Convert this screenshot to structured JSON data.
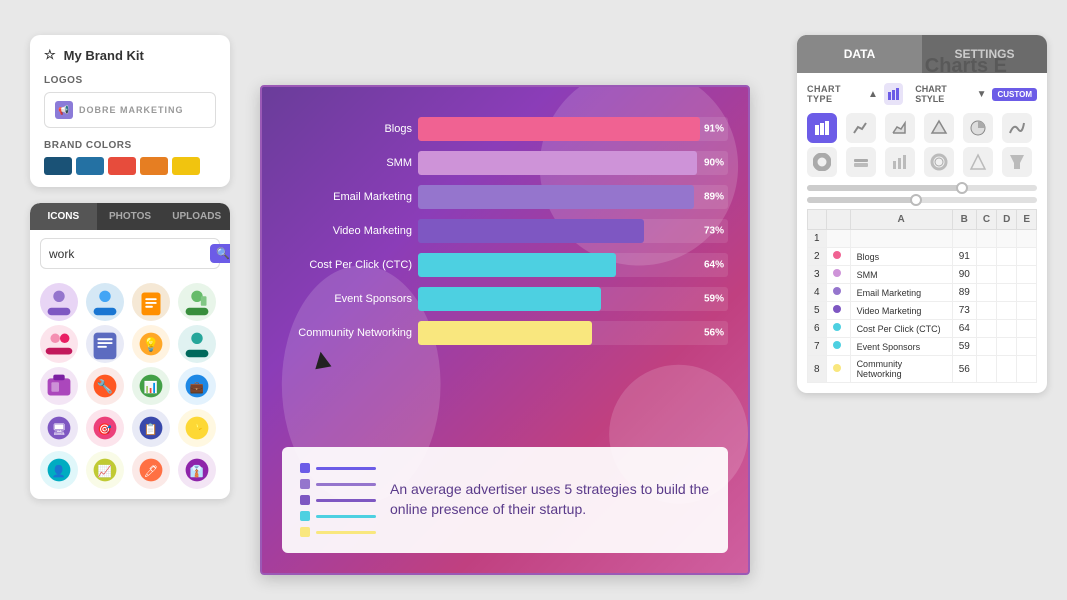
{
  "brandKit": {
    "title": "My Brand Kit",
    "logosLabel": "LOGOS",
    "logoText": "DOBRE MARKETING",
    "brandColorsLabel": "BRAND COLORS",
    "colors": [
      "#1a5276",
      "#2471a3",
      "#e74c3c",
      "#e67e22",
      "#f1c40f"
    ]
  },
  "iconsPanel": {
    "tabs": [
      "ICONS",
      "PHOTOS",
      "UPLOADS"
    ],
    "activeTab": 0,
    "searchPlaceholder": "work",
    "searchLabel": "search"
  },
  "chart": {
    "title": "Charts E",
    "bars": [
      {
        "label": "Blogs",
        "pct": 91,
        "color": "#f06292"
      },
      {
        "label": "SMM",
        "pct": 90,
        "color": "#ce93d8"
      },
      {
        "label": "Email Marketing",
        "pct": 89,
        "color": "#9575cd"
      },
      {
        "label": "Video Marketing",
        "pct": 73,
        "color": "#7e57c2"
      },
      {
        "label": "Cost Per Click (CTC)",
        "pct": 64,
        "color": "#4dd0e1"
      },
      {
        "label": "Event Sponsors",
        "pct": 59,
        "color": "#4dd0e1"
      },
      {
        "label": "Community Networking",
        "pct": 56,
        "color": "#f9e77e"
      }
    ],
    "bottomText": "An average advertiser uses 5 strategies to build the online presence of their startup.",
    "legendColors": [
      "#6c5ce7",
      "#9575cd",
      "#7e57c2",
      "#4dd0e1",
      "#f9e77e"
    ]
  },
  "rightPanel": {
    "tabs": [
      "DATA",
      "SETTINGS"
    ],
    "activeTab": 0,
    "chartTypeLabel": "CHART TYPE",
    "chartStyleLabel": "CHART STYLE",
    "customLabel": "CUSTOM",
    "sliders": [
      {
        "value": 70
      },
      {
        "value": 50
      }
    ],
    "spreadsheet": {
      "headers": [
        "",
        "",
        "A",
        "B",
        "C",
        "D",
        "E"
      ],
      "rows": [
        {
          "num": "1",
          "color": null,
          "cells": [
            "",
            "",
            "",
            "",
            ""
          ]
        },
        {
          "num": "2",
          "color": "#f06292",
          "label": "Blogs",
          "value": "91",
          "cells": [
            "",
            "",
            ""
          ]
        },
        {
          "num": "3",
          "color": "#ce93d8",
          "label": "SMM",
          "value": "90",
          "cells": [
            "",
            "",
            ""
          ]
        },
        {
          "num": "4",
          "color": "#9575cd",
          "label": "Email Marketing",
          "value": "89",
          "cells": [
            "",
            "",
            ""
          ]
        },
        {
          "num": "5",
          "color": "#7e57c2",
          "label": "Video Marketing",
          "value": "73",
          "cells": [
            "",
            "",
            ""
          ]
        },
        {
          "num": "6",
          "color": "#4dd0e1",
          "label": "Cost Per Click (CTC)",
          "value": "64",
          "cells": [
            "",
            "",
            ""
          ]
        },
        {
          "num": "7",
          "color": "#4dd0e1",
          "label": "Event Sponsors",
          "value": "59",
          "cells": [
            "",
            "",
            ""
          ]
        },
        {
          "num": "8",
          "color": "#f9e77e",
          "label": "Community Networking",
          "value": "56",
          "cells": [
            "",
            "",
            ""
          ]
        }
      ]
    }
  }
}
